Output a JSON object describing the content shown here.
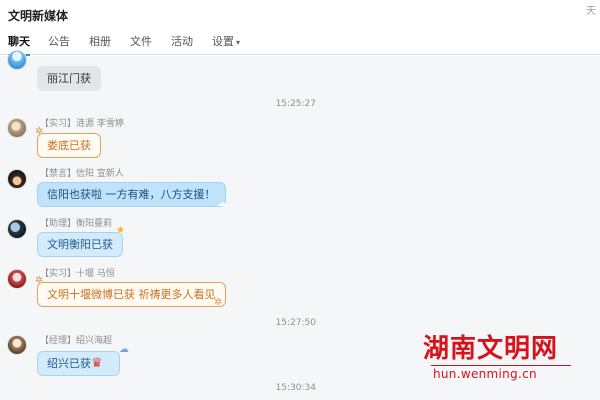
{
  "window": {
    "title": "文明新媒体",
    "corner_text": "天"
  },
  "tabs": [
    {
      "label": "聊天",
      "active": true
    },
    {
      "label": "公告"
    },
    {
      "label": "相册"
    },
    {
      "label": "文件"
    },
    {
      "label": "活动"
    },
    {
      "label": "设置",
      "has_dropdown": true
    }
  ],
  "messages": [
    {
      "sender": "",
      "text": "丽江门获",
      "avatar_icon": "avatar-blue-icon",
      "style": "gray"
    },
    {
      "time": "15:25:27"
    },
    {
      "sender": "【实习】涟源 李雪婷",
      "text": "娄底已获",
      "avatar_icon": "avatar-puppy-icon",
      "style": "orange"
    },
    {
      "sender": "【禁言】信阳 宣新人",
      "text": "信阳也获啦 一方有难，八方支援！",
      "avatar_icon": "avatar-girl-icon",
      "style": "blue"
    },
    {
      "sender": "【助理】衡阳蔓莉",
      "text": "文明衡阳已获",
      "avatar_icon": "avatar-dark-icon",
      "style": "lightblue"
    },
    {
      "sender": "【实习】十堰 马恒",
      "text": "文明十堰微博已获 祈祷更多人看见",
      "avatar_icon": "avatar-red-icon",
      "style": "orange"
    },
    {
      "time": "15:27:50"
    },
    {
      "sender": "【经理】绍兴海超",
      "text": "绍兴已获",
      "avatar_icon": "avatar-cat-icon",
      "style": "lightblue"
    },
    {
      "time": "15:30:34"
    }
  ],
  "watermark": {
    "name": "湖南文明网",
    "url": "hun.wenming.cn"
  },
  "colors": {
    "accent": "#1f8ce8",
    "watermark_red": "#d8121a",
    "orange_text": "#c9731d"
  }
}
